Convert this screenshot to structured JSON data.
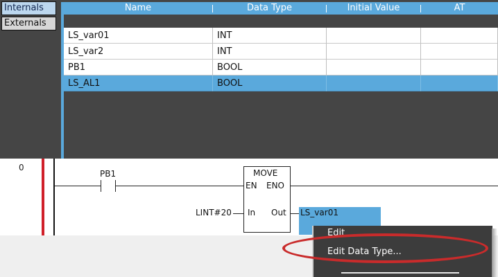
{
  "side_tabs": {
    "internals": "Internals",
    "externals": "Externals"
  },
  "table": {
    "headers": {
      "name": "Name",
      "data_type": "Data Type",
      "initial_value": "Initial Value",
      "at": "AT"
    },
    "rows": [
      {
        "name": "LS_var01",
        "data_type": "INT"
      },
      {
        "name": "LS_var2",
        "data_type": "INT"
      },
      {
        "name": "PB1",
        "data_type": "BOOL"
      },
      {
        "name": "LS_AL1",
        "data_type": "BOOL"
      }
    ],
    "selected_row": "LS_AL1"
  },
  "ladder": {
    "rung_number": "0",
    "contact_label": "PB1",
    "fb_title": "MOVE",
    "fb_en": "EN",
    "fb_eno": "ENO",
    "fb_in": "In",
    "fb_out": "Out",
    "in_value": "LINT#20",
    "out_variable": "LS_var01"
  },
  "context_menu": {
    "items": [
      "Edit",
      "Edit Data Type..."
    ],
    "highlighted": "Edit Data Type..."
  },
  "colors": {
    "selection_blue": "#5aa9dc",
    "dark_panel": "#454545",
    "rail_red": "#d0202a",
    "annotation_red": "#c92b2b"
  }
}
